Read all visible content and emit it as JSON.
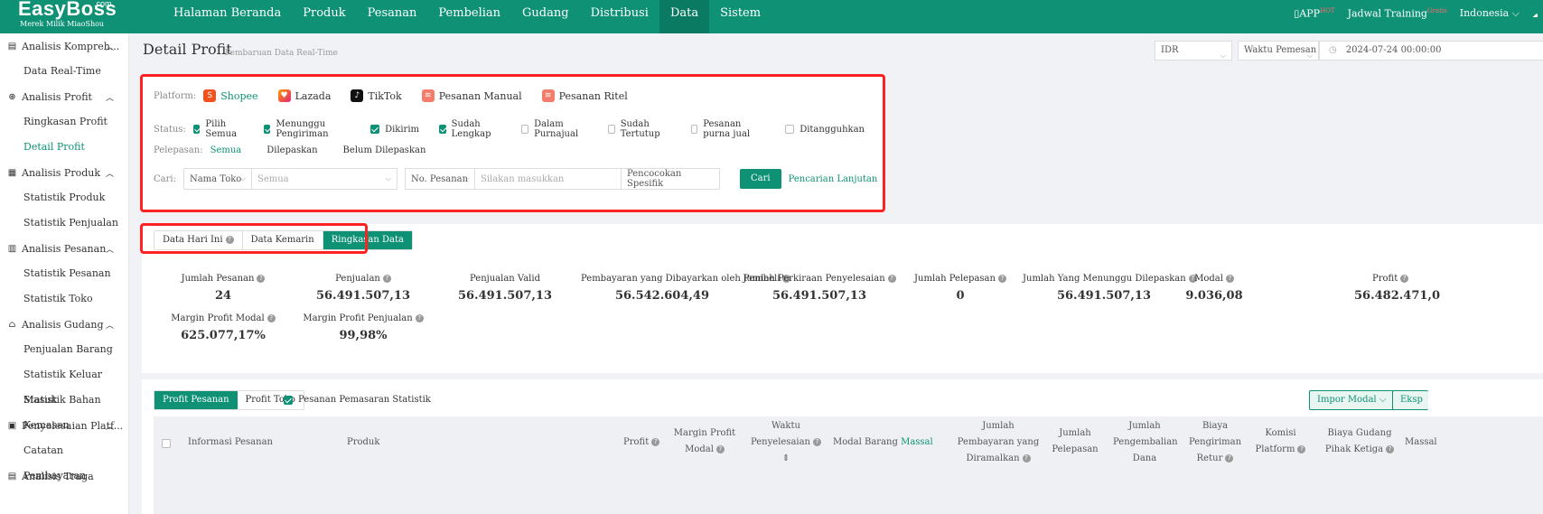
{
  "app": {
    "logo": "EasyBoss",
    "logo_com": ".com",
    "logo_sub": "Merek Milik MiaoShou"
  },
  "topnav": [
    "Halaman Beranda",
    "Produk",
    "Pesanan",
    "Pembelian",
    "Gudang",
    "Distribusi",
    "Data",
    "Sistem"
  ],
  "topright": {
    "app": "APP",
    "hot": "HOT",
    "training": "Jadwal Training",
    "gratis": "Gratis",
    "lang": "Indonesia"
  },
  "sidebar": [
    {
      "label": "Analisis Kompreh...",
      "items": [
        "Data Real-Time"
      ]
    },
    {
      "label": "Analisis Profit",
      "items": [
        "Ringkasan Profit",
        "Detail Profit"
      ]
    },
    {
      "label": "Analisis Produk",
      "items": [
        "Statistik Produk",
        "Statistik Penjualan"
      ]
    },
    {
      "label": "Analisis Pesanan",
      "items": [
        "Statistik Pesanan",
        "Statistik Toko"
      ]
    },
    {
      "label": "Analisis Gudang",
      "items": [
        "Penjualan Barang",
        "Statistik Keluar Masuk",
        "Statistik Bahan Kemasan"
      ]
    },
    {
      "label": "Penyelesaian Platf...",
      "items": [
        "Catatan Pembayaran"
      ]
    },
    {
      "label": "Analisis Traga",
      "items": []
    }
  ],
  "page": {
    "title": "Detail Profit",
    "subtitle": "Pembaruan Data Real-Time",
    "currency": "IDR",
    "time_type": "Waktu Pemesan",
    "date": "2024-07-24 00:00:00"
  },
  "filter": {
    "platform_label": "Platform:",
    "platforms": [
      "Shopee",
      "Lazada",
      "TikTok",
      "Pesanan Manual",
      "Pesanan Ritel"
    ],
    "status_label": "Status:",
    "statuses": [
      {
        "label": "Pilih Semua",
        "checked": true
      },
      {
        "label": "Menunggu Pengiriman",
        "checked": true
      },
      {
        "label": "Dikirim",
        "checked": true
      },
      {
        "label": "Sudah Lengkap",
        "checked": true
      },
      {
        "label": "Dalam Purnajual",
        "checked": false
      },
      {
        "label": "Sudah Tertutup",
        "checked": false
      },
      {
        "label": "Pesanan purna jual",
        "checked": false
      },
      {
        "label": "Ditangguhkan",
        "checked": false
      }
    ],
    "release_label": "Pelepasan:",
    "release": [
      "Semua",
      "Dilepaskan",
      "Belum Dilepaskan"
    ],
    "search_label": "Cari:",
    "store_select": "Nama Toko",
    "store_value": "Semua",
    "order_select": "No. Pesanan",
    "order_placeholder": "Silakan masukkan",
    "match": "Pencocokan Spesifik",
    "search_btn": "Cari",
    "advanced": "Pencarian Lanjutan"
  },
  "tabs": [
    "Data Hari Ini",
    "Data Kemarin",
    "Ringkasan Data"
  ],
  "stats": [
    {
      "label": "Jumlah Pesanan",
      "value": "24"
    },
    {
      "label": "Penjualan",
      "value": "56.491.507,13"
    },
    {
      "label": "Penjualan Valid",
      "value": "56.491.507,13"
    },
    {
      "label": "Pembayaran yang Dibayarkan oleh Pembeli",
      "value": "56.542.604,49"
    },
    {
      "label": "Jumlah Perkiraan Penyelesaian",
      "value": "56.491.507,13"
    },
    {
      "label": "Jumlah Pelepasan",
      "value": "0"
    },
    {
      "label": "Jumlah Yang Menunggu Dilepaskan",
      "value": "56.491.507,13"
    },
    {
      "label": "Modal",
      "value": "9.036,08"
    },
    {
      "label": "Profit",
      "value": "56.482.471,0"
    },
    {
      "label": "Margin Profit Modal",
      "value": "625.077,17%"
    },
    {
      "label": "Margin Profit Penjualan",
      "value": "99,98%"
    }
  ],
  "table": {
    "subtabs": [
      "Profit Pesanan",
      "Profit Toko"
    ],
    "marketing": "Pesanan Pemasaran Statistik",
    "impor": "Impor Modal",
    "ekspor": "Eksp",
    "headers": {
      "info": "Informasi Pesanan",
      "produk": "Produk",
      "profit": "Profit",
      "margin": "Margin Profit Modal",
      "waktu": "Waktu Penyelesaian",
      "modal": "Modal Barang",
      "massal": "Massal",
      "bayar": "Jumlah Pembayaran yang Diramalkan",
      "pelepasan": "Jumlah Pelepasan",
      "kembali": "Jumlah Pengembalian Dana",
      "kirim": "Biaya Pengiriman Retur",
      "komisi": "Komisi Platform",
      "gudang": "Biaya Gudang Pihak Ketiga",
      "massal2": "Massal"
    }
  }
}
